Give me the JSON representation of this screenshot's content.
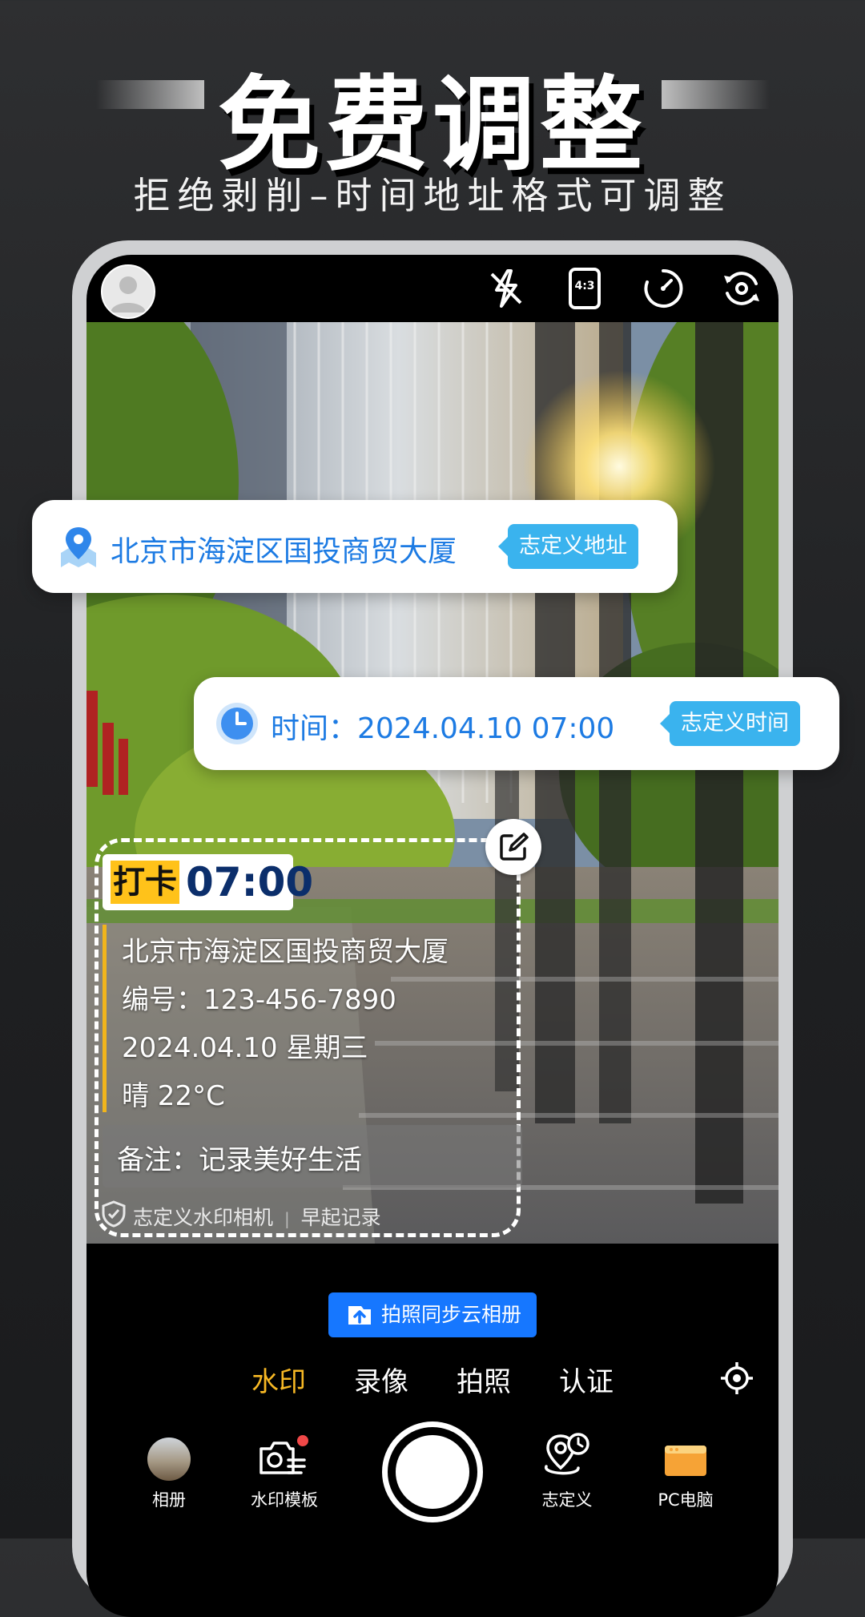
{
  "hero": {
    "title": "免费调整",
    "subtitle": "拒绝剥削–时间地址格式可调整"
  },
  "topbar": {
    "icons": [
      "avatar-icon",
      "flash-off-icon",
      "aspect-ratio-icon",
      "timer-icon",
      "switch-camera-icon"
    ],
    "aspect_label": "4:3"
  },
  "address_card": {
    "text": "北京市海淀区国投商贸大厦",
    "tag": "志定义地址"
  },
  "time_card": {
    "text": "时间：2024.04.10 07:00",
    "tag": "志定义时间"
  },
  "watermark": {
    "badge": "打卡",
    "time": "07:00",
    "address": "北京市海淀区国投商贸大厦",
    "number": "编号：123-456-7890",
    "date": "2024.04.10 星期三",
    "weather": "晴 22°C",
    "note": "备注：记录美好生活",
    "footer_brand": "志定义水印相机",
    "footer_sep": "|",
    "footer_tag": "早起记录"
  },
  "sync_button": {
    "label": "拍照同步云相册"
  },
  "modes": [
    {
      "label": "水印",
      "active": true
    },
    {
      "label": "录像",
      "active": false
    },
    {
      "label": "拍照",
      "active": false
    },
    {
      "label": "认证",
      "active": false
    }
  ],
  "bottom_nav": [
    {
      "label": "相册"
    },
    {
      "label": "水印模板"
    },
    {
      "label": "志定义"
    },
    {
      "label": "PC电脑"
    }
  ],
  "colors": {
    "accent_blue": "#1d7be3",
    "tag_blue": "#3ab3ee",
    "badge_yellow": "#ffc21a",
    "active_mode": "#f7b824",
    "sync_blue": "#1677ff"
  }
}
